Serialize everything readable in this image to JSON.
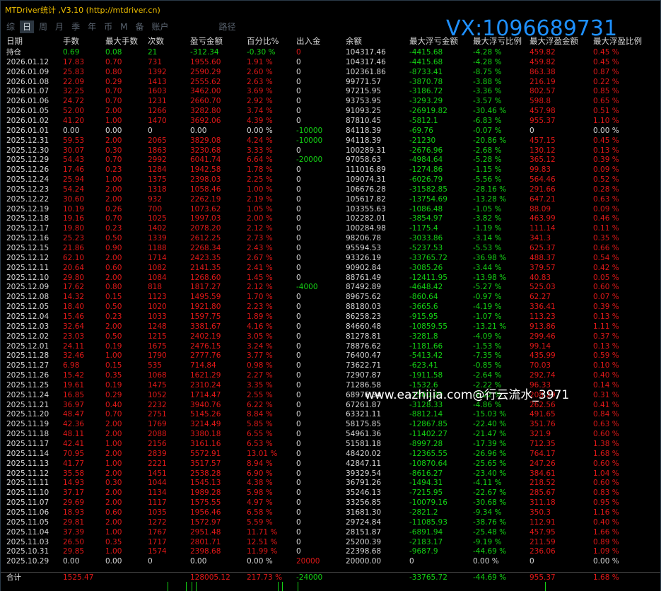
{
  "window": {
    "title": "MTDriver统计 ,V3.10 (http://mtdriver.cn)"
  },
  "watermark": {
    "vx": "VX:1096689731",
    "site": "www.eazhijia.com@行云流水_3971"
  },
  "tabs": [
    {
      "label": "综"
    },
    {
      "label": "日"
    },
    {
      "label": "周"
    },
    {
      "label": "月"
    },
    {
      "label": "季"
    },
    {
      "label": "年"
    },
    {
      "label": "币"
    },
    {
      "label": "M"
    },
    {
      "label": "备"
    },
    {
      "label": "账户"
    },
    {
      "label": "路径"
    }
  ],
  "active_tab": "日",
  "headers": [
    "日期",
    "手数",
    "最大手数",
    "次数",
    "盈亏金额",
    "百分比%",
    "出入金",
    "余额",
    "最大浮亏金额",
    "最大浮亏比例",
    "最大浮盈金额",
    "最大浮盈比例"
  ],
  "colors": {
    "negative": "#e01818",
    "positive": "#14d214",
    "text": "#d8d8d8",
    "title": "#f0c000",
    "watermark": "#1e90ff"
  },
  "rows": [
    [
      "持仓",
      "0.69",
      "0.08",
      "21",
      "-312.34",
      "-0.30 %",
      "0",
      "104317.46",
      "-4415.68",
      "-4.28 %",
      "459.82",
      "0.45 %"
    ],
    [
      "2026.01.12",
      "17.83",
      "0.70",
      "731",
      "1955.60",
      "1.91 %",
      "0",
      "104317.46",
      "-4415.68",
      "-4.28 %",
      "459.82",
      "0.45 %"
    ],
    [
      "2026.01.09",
      "25.83",
      "0.80",
      "1392",
      "2590.29",
      "2.60 %",
      "0",
      "102361.86",
      "-8733.41",
      "-8.75 %",
      "863.38",
      "0.87 %"
    ],
    [
      "2026.01.08",
      "22.09",
      "0.29",
      "1413",
      "2555.62",
      "2.63 %",
      "0",
      "99771.57",
      "-3870.78",
      "-3.88 %",
      "216.19",
      "0.22 %"
    ],
    [
      "2026.01.07",
      "32.25",
      "0.70",
      "1603",
      "3462.00",
      "3.69 %",
      "0",
      "97215.95",
      "-3186.72",
      "-3.36 %",
      "802.57",
      "0.85 %"
    ],
    [
      "2026.01.06",
      "24.72",
      "0.70",
      "1231",
      "2660.70",
      "2.92 %",
      "0",
      "93753.95",
      "-3293.29",
      "-3.57 %",
      "598.8",
      "0.65 %"
    ],
    [
      "2026.01.05",
      "52.00",
      "2.00",
      "1266",
      "3282.80",
      "3.74 %",
      "0",
      "91093.25",
      "-26919.82",
      "-30.46 %",
      "457.98",
      "0.51 %"
    ],
    [
      "2026.01.02",
      "41.20",
      "1.00",
      "1470",
      "3692.06",
      "4.39 %",
      "0",
      "87810.45",
      "-5812.1",
      "-6.83 %",
      "955.37",
      "1.10 %"
    ],
    [
      "2026.01.01",
      "0.00",
      "0.00",
      "0",
      "0.00",
      "0.00 %",
      "-10000",
      "84118.39",
      "-69.76",
      "-0.07 %",
      "0",
      "0.00 %"
    ],
    [
      "2025.12.31",
      "59.53",
      "2.00",
      "2065",
      "3829.08",
      "4.24 %",
      "-10000",
      "94118.39",
      "-21230",
      "-20.86 %",
      "457.15",
      "0.45 %"
    ],
    [
      "2025.12.30",
      "30.07",
      "0.30",
      "1863",
      "3230.68",
      "3.33 %",
      "0",
      "100289.31",
      "-2676.96",
      "-2.68 %",
      "130.12",
      "0.13 %"
    ],
    [
      "2025.12.29",
      "54.43",
      "0.70",
      "2992",
      "6041.74",
      "6.64 %",
      "-20000",
      "97058.63",
      "-4984.64",
      "-5.28 %",
      "365.12",
      "0.39 %"
    ],
    [
      "2025.12.26",
      "17.46",
      "0.23",
      "1284",
      "1942.58",
      "1.78 %",
      "0",
      "111016.89",
      "-1274.86",
      "-1.15 %",
      "99.83",
      "0.09 %"
    ],
    [
      "2025.12.24",
      "25.94",
      "1.00",
      "1375",
      "2398.03",
      "2.25 %",
      "0",
      "109074.31",
      "-6026.79",
      "-5.56 %",
      "564.46",
      "0.52 %"
    ],
    [
      "2025.12.23",
      "54.24",
      "2.00",
      "1318",
      "1058.46",
      "1.00 %",
      "0",
      "106676.28",
      "-31582.85",
      "-28.16 %",
      "291.66",
      "0.28 %"
    ],
    [
      "2025.12.22",
      "30.60",
      "2.00",
      "932",
      "2262.19",
      "2.19 %",
      "0",
      "105617.82",
      "-13754.69",
      "-13.28 %",
      "647.21",
      "0.63 %"
    ],
    [
      "2025.12.19",
      "10.19",
      "0.26",
      "700",
      "1073.62",
      "1.05 %",
      "0",
      "103355.63",
      "-1086.48",
      "-1.05 %",
      "88.09",
      "0.09 %"
    ],
    [
      "2025.12.18",
      "19.16",
      "0.70",
      "1025",
      "1997.03",
      "2.00 %",
      "0",
      "102282.01",
      "-3854.97",
      "-3.82 %",
      "463.99",
      "0.46 %"
    ],
    [
      "2025.12.17",
      "19.80",
      "0.23",
      "1402",
      "2078.20",
      "2.12 %",
      "0",
      "100284.98",
      "-1175.4",
      "-1.19 %",
      "111.14",
      "0.11 %"
    ],
    [
      "2025.12.16",
      "25.23",
      "0.50",
      "1339",
      "2612.25",
      "2.73 %",
      "0",
      "98206.78",
      "-3033.86",
      "-3.14 %",
      "341.3",
      "0.35 %"
    ],
    [
      "2025.12.15",
      "21.86",
      "0.90",
      "1188",
      "2268.34",
      "2.43 %",
      "0",
      "95594.53",
      "-5237.53",
      "-5.53 %",
      "625.37",
      "0.66 %"
    ],
    [
      "2025.12.12",
      "62.10",
      "2.00",
      "1714",
      "2423.35",
      "2.67 %",
      "0",
      "93326.19",
      "-33765.72",
      "-36.98 %",
      "488.37",
      "0.54 %"
    ],
    [
      "2025.12.11",
      "20.64",
      "0.60",
      "1082",
      "2141.35",
      "2.41 %",
      "0",
      "90902.84",
      "-3085.26",
      "-3.44 %",
      "379.57",
      "0.42 %"
    ],
    [
      "2025.12.10",
      "29.80",
      "2.00",
      "1084",
      "1268.60",
      "1.45 %",
      "0",
      "88761.49",
      "-12411.95",
      "-13.98 %",
      "40.83",
      "0.05 %"
    ],
    [
      "2025.12.09",
      "17.62",
      "0.80",
      "818",
      "1817.27",
      "2.12 %",
      "-4000",
      "87492.89",
      "-4648.42",
      "-5.27 %",
      "525.03",
      "0.60 %"
    ],
    [
      "2025.12.08",
      "14.32",
      "0.15",
      "1123",
      "1495.59",
      "1.70 %",
      "0",
      "89675.62",
      "-860.64",
      "-0.97 %",
      "62.27",
      "0.07 %"
    ],
    [
      "2025.12.05",
      "18.40",
      "0.50",
      "1020",
      "1921.80",
      "2.23 %",
      "0",
      "88180.03",
      "-3665.6",
      "-4.19 %",
      "336.41",
      "0.39 %"
    ],
    [
      "2025.12.04",
      "15.46",
      "0.23",
      "1033",
      "1597.75",
      "1.89 %",
      "0",
      "86258.23",
      "-915.95",
      "-1.07 %",
      "113.23",
      "0.13 %"
    ],
    [
      "2025.12.03",
      "32.64",
      "2.00",
      "1248",
      "3381.67",
      "4.16 %",
      "0",
      "84660.48",
      "-10859.55",
      "-13.21 %",
      "913.86",
      "1.11 %"
    ],
    [
      "2025.12.02",
      "23.03",
      "0.50",
      "1215",
      "2402.19",
      "3.05 %",
      "0",
      "81278.81",
      "-3281.8",
      "-4.09 %",
      "299.46",
      "0.37 %"
    ],
    [
      "2025.12.01",
      "24.11",
      "0.19",
      "1675",
      "2476.15",
      "3.24 %",
      "0",
      "78876.62",
      "-1181.66",
      "-1.53 %",
      "99.14",
      "0.13 %"
    ],
    [
      "2025.11.28",
      "32.46",
      "1.00",
      "1790",
      "2777.76",
      "3.77 %",
      "0",
      "76400.47",
      "-5413.42",
      "-7.35 %",
      "435.99",
      "0.59 %"
    ],
    [
      "2025.11.27",
      "6.98",
      "0.15",
      "535",
      "714.84",
      "0.98 %",
      "0",
      "73622.71",
      "-623.41",
      "-0.85 %",
      "70.03",
      "0.10 %"
    ],
    [
      "2025.11.26",
      "15.42",
      "0.35",
      "1068",
      "1621.29",
      "2.27 %",
      "0",
      "72907.87",
      "-1911.58",
      "-2.64 %",
      "292.74",
      "0.40 %"
    ],
    [
      "2025.11.25",
      "19.61",
      "0.19",
      "1475",
      "2310.24",
      "3.35 %",
      "0",
      "71286.58",
      "-1532.6",
      "-2.22 %",
      "96.33",
      "0.14 %"
    ],
    [
      "2025.11.24",
      "16.85",
      "0.29",
      "1052",
      "1714.47",
      "2.55 %",
      "0",
      "68976.34",
      "-1500.29",
      "-2.22 %",
      "208.29",
      "0.31 %"
    ],
    [
      "2025.11.21",
      "36.97",
      "0.40",
      "2232",
      "3940.76",
      "6.22 %",
      "0",
      "67261.87",
      "-3128.33",
      "-4.86 %",
      "262.56",
      "0.41 %"
    ],
    [
      "2025.11.20",
      "48.47",
      "0.70",
      "2751",
      "5145.26",
      "8.84 %",
      "0",
      "63321.11",
      "-8812.14",
      "-15.03 %",
      "491.65",
      "0.84 %"
    ],
    [
      "2025.11.19",
      "42.36",
      "2.00",
      "1769",
      "3214.49",
      "5.85 %",
      "0",
      "58175.85",
      "-12867.85",
      "-22.40 %",
      "351.76",
      "0.63 %"
    ],
    [
      "2025.11.18",
      "48.11",
      "2.00",
      "2088",
      "3380.18",
      "6.55 %",
      "0",
      "54961.36",
      "-11402.27",
      "-21.47 %",
      "321.9",
      "0.60 %"
    ],
    [
      "2025.11.17",
      "42.41",
      "1.00",
      "2156",
      "3161.16",
      "6.53 %",
      "0",
      "51581.18",
      "-8997.28",
      "-17.39 %",
      "712.35",
      "1.38 %"
    ],
    [
      "2025.11.14",
      "70.95",
      "2.00",
      "2839",
      "5572.91",
      "13.01 %",
      "0",
      "48420.02",
      "-12365.55",
      "-26.96 %",
      "764.17",
      "1.68 %"
    ],
    [
      "2025.11.13",
      "41.77",
      "1.00",
      "2221",
      "3517.57",
      "8.94 %",
      "0",
      "42847.11",
      "-10870.64",
      "-25.65 %",
      "247.26",
      "0.60 %"
    ],
    [
      "2025.11.12",
      "35.58",
      "2.00",
      "1451",
      "2538.28",
      "6.90 %",
      "0",
      "39329.54",
      "-8616.27",
      "-23.40 %",
      "384.61",
      "1.04 %"
    ],
    [
      "2025.11.11",
      "14.93",
      "0.30",
      "1044",
      "1545.13",
      "4.38 %",
      "0",
      "36791.26",
      "-1494.31",
      "-4.11 %",
      "218.52",
      "0.60 %"
    ],
    [
      "2025.11.10",
      "37.17",
      "2.00",
      "1134",
      "1989.28",
      "5.98 %",
      "0",
      "35246.13",
      "-7215.95",
      "-22.67 %",
      "285.67",
      "0.83 %"
    ],
    [
      "2025.11.07",
      "29.69",
      "2.00",
      "1117",
      "1575.55",
      "4.97 %",
      "0",
      "33256.85",
      "-10079.16",
      "-30.68 %",
      "311.18",
      "0.95 %"
    ],
    [
      "2025.11.06",
      "18.93",
      "0.60",
      "1035",
      "1956.46",
      "6.58 %",
      "0",
      "31681.30",
      "-2821.2",
      "-9.34 %",
      "350.3",
      "1.16 %"
    ],
    [
      "2025.11.05",
      "29.81",
      "2.00",
      "1272",
      "1572.97",
      "5.59 %",
      "0",
      "29724.84",
      "-11085.93",
      "-38.76 %",
      "112.91",
      "0.40 %"
    ],
    [
      "2025.11.04",
      "37.39",
      "1.00",
      "1767",
      "2951.48",
      "11.71 %",
      "0",
      "28151.87",
      "-6891.94",
      "-25.48 %",
      "457.95",
      "1.66 %"
    ],
    [
      "2025.11.03",
      "26.50",
      "0.35",
      "1717",
      "2801.71",
      "12.51 %",
      "0",
      "25200.39",
      "-2183.17",
      "-9.19 %",
      "211.59",
      "0.89 %"
    ],
    [
      "2025.10.31",
      "29.85",
      "1.00",
      "1574",
      "2398.68",
      "11.99 %",
      "0",
      "22398.68",
      "-9687.9",
      "-44.69 %",
      "236.06",
      "1.09 %"
    ],
    [
      "2025.10.29",
      "0.00",
      "0.00",
      "0",
      "0.00",
      "0.00 %",
      "20000",
      "20000.00",
      "0",
      "0.00 %",
      "0",
      "0.00 %"
    ]
  ],
  "total": [
    "合计",
    "1525.47",
    "",
    "",
    "128005.12",
    "217.73 %",
    "-24000",
    "",
    "-33765.72",
    "-44.69 %",
    "955.37",
    "1.68 %"
  ]
}
